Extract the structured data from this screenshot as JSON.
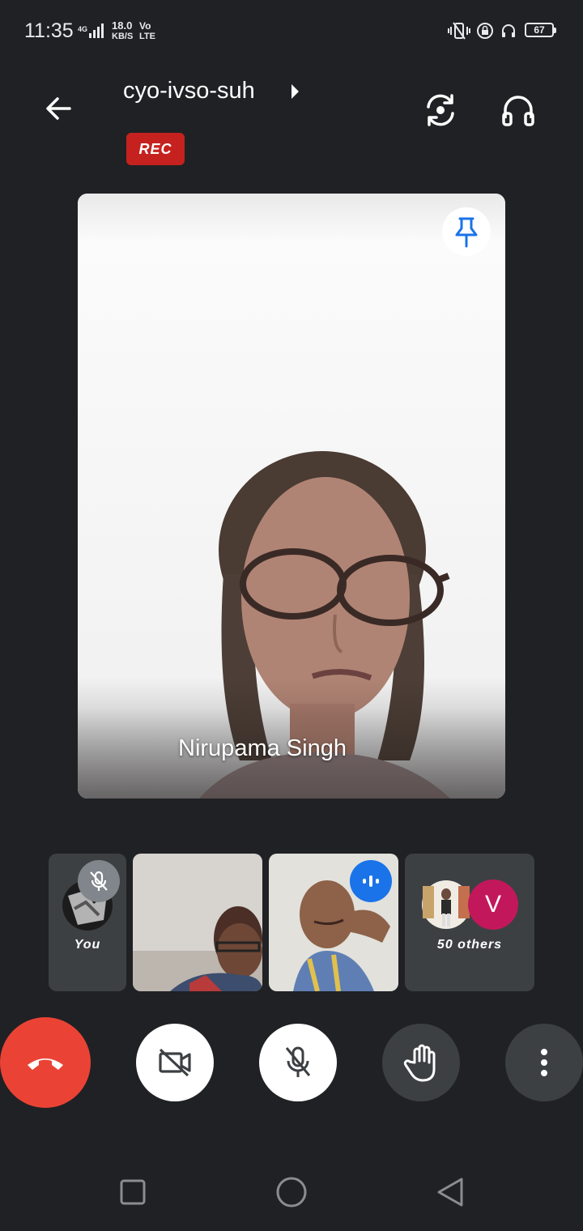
{
  "status_bar": {
    "time": "11:35",
    "network_type": "4G",
    "data_speed": "18.0",
    "data_unit": "KB/S",
    "volte_top": "Vo",
    "volte_bottom": "LTE",
    "battery": "67",
    "icons": [
      "vibrate-icon",
      "lock-rotation-icon",
      "headphones-status-icon"
    ]
  },
  "header": {
    "back_icon": "arrow-back-icon",
    "meeting_code": "cyo-ivso-suh",
    "rec_badge": "REC",
    "switch_camera_icon": "switch-camera-icon",
    "audio_icon": "headphones-icon"
  },
  "main_tile": {
    "speaker_name": "Nirupama Singh",
    "pin_icon": "pin-icon"
  },
  "participants": {
    "self_label": "You",
    "others_label": "50 others",
    "others_avatar_letter": "V"
  },
  "controls": {
    "icons": [
      "end-call-icon",
      "camera-off-icon",
      "mic-off-icon",
      "raise-hand-icon",
      "more-vert-icon"
    ]
  },
  "colors": {
    "background": "#202124",
    "end_call": "#ea4335",
    "rec": "#c5221f",
    "active_speaker": "#1a73e8",
    "avatar_v": "#c2185b"
  }
}
